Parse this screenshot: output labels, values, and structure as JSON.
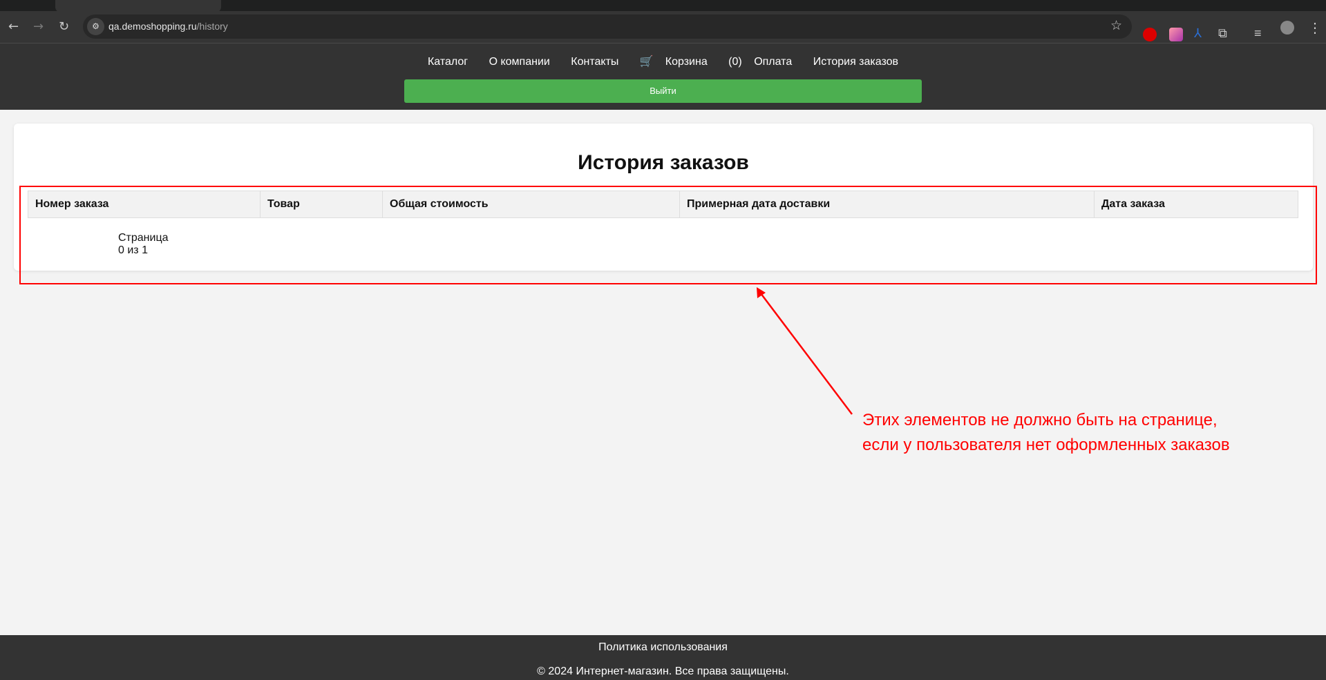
{
  "browser": {
    "url_host": "qa.demoshopping.ru",
    "url_path": "/history"
  },
  "nav": {
    "items": [
      "Каталог",
      "О компании",
      "Контакты"
    ],
    "cart": "Корзина",
    "cart_count": "(0)",
    "payment": "Оплата",
    "history": "История заказов",
    "logout": "Выйти"
  },
  "main": {
    "title": "История заказов",
    "columns": [
      "Номер заказа",
      "Товар",
      "Общая стоимость",
      "Примерная дата доставки",
      "Дата заказа"
    ],
    "page_label": "Страница",
    "page_value": "0 из 1"
  },
  "annotation": {
    "line1": "Этих элементов не должно быть на странице,",
    "line2": "если у пользователя нет оформленных заказов",
    "color": "#ff0000"
  },
  "footer": {
    "policy": "Политика использования",
    "copyright": "© 2024 Интернет-магазин. Все права защищены."
  }
}
